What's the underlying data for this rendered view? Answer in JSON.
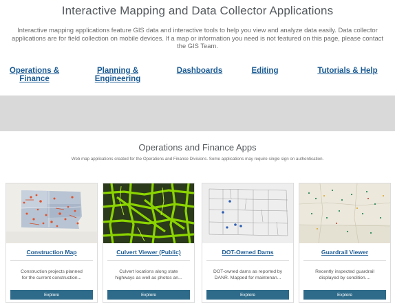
{
  "header": {
    "title": "Interactive Mapping and Data Collector Applications",
    "intro": "Interactive mapping applications feature GIS data and interactive tools to help you view and analyze data easily. Data collector applications are for field collection on mobile devices. If a map or information you need is not featured on this page, please contact the GIS Team."
  },
  "nav": {
    "links": [
      {
        "line1": "Operations &",
        "line2": "Finance"
      },
      {
        "line1": "Planning &",
        "line2": "Engineering"
      },
      {
        "line1": "Dashboards",
        "line2": ""
      },
      {
        "line1": "Editing",
        "line2": ""
      },
      {
        "line1": "Tutorials & Help",
        "line2": ""
      }
    ]
  },
  "section": {
    "title": "Operations and Finance Apps",
    "subtitle": "Web map applications created for the Operations and Finance Divisions. Some applications may require single sign on authentication."
  },
  "cards": [
    {
      "title": "Construction Map",
      "desc_line1": "Construction projects planned",
      "desc_line2": "for the current construction...",
      "button": "Explore",
      "thumb_icon": "construction-map-thumbnail"
    },
    {
      "title": "Culvert Viewer (Public)",
      "desc_line1": "Culvert locations along state",
      "desc_line2": "highways as well as photos an...",
      "button": "Explore",
      "thumb_icon": "culvert-map-thumbnail"
    },
    {
      "title": "DOT-Owned Dams",
      "desc_line1": "DOT-owned dams as reported by",
      "desc_line2": "DANR. Mapped for maintenan...",
      "button": "Explore",
      "thumb_icon": "dams-map-thumbnail"
    },
    {
      "title": "Guardrail Viewer",
      "desc_line1": "Recently inspected guardrail",
      "desc_line2": "displayed by condition....",
      "button": "Explore",
      "thumb_icon": "guardrail-map-thumbnail"
    }
  ],
  "colors": {
    "link": "#1a5a93",
    "band": "#d9d9d9",
    "button": "#2e6b8a",
    "culvert_green": "#8bd400"
  }
}
